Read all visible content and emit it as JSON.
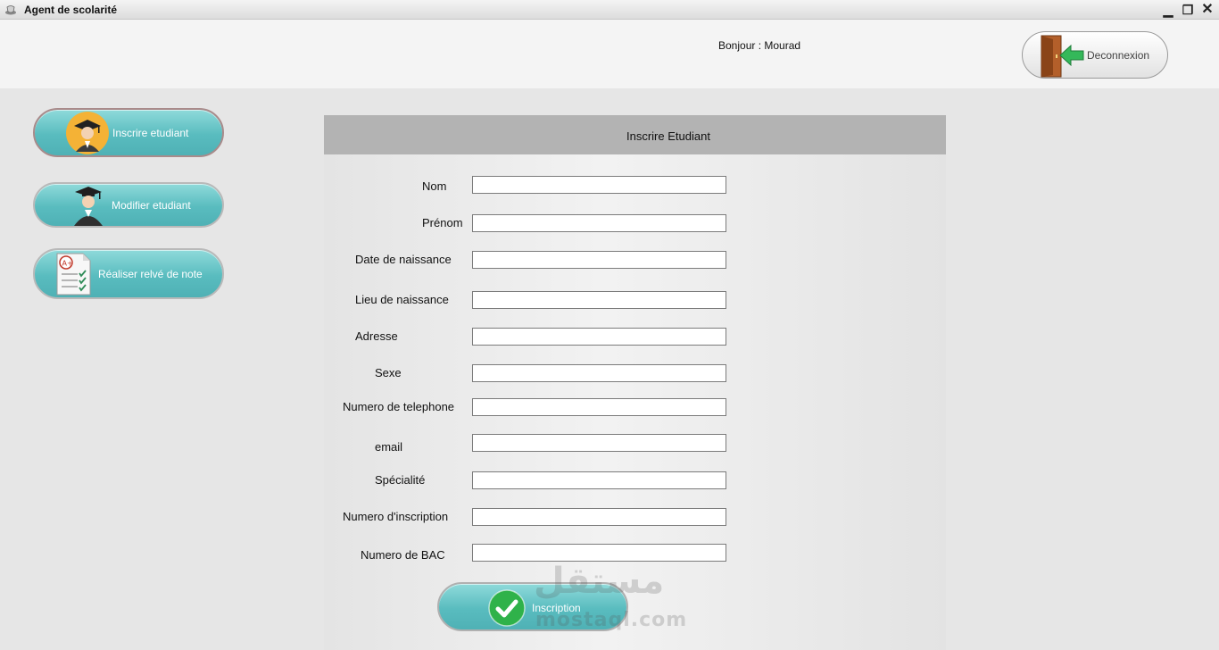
{
  "window": {
    "title": "Agent de scolarité",
    "minimize_glyph": "▁",
    "maximize_glyph": "❐",
    "close_glyph": "✕"
  },
  "header": {
    "greeting": "Bonjour : Mourad",
    "logout_label": "Deconnexion",
    "logout_icon": "door-exit-icon"
  },
  "sidebar": {
    "items": [
      {
        "label": "Inscrire etudiant",
        "icon": "graduate-student-icon"
      },
      {
        "label": "Modifier etudiant",
        "icon": "graduate-icon"
      },
      {
        "label": "Réaliser relvé de note",
        "icon": "grade-report-icon"
      }
    ]
  },
  "form": {
    "title": "Inscrire Etudiant",
    "fields": [
      {
        "label": "Nom",
        "value": ""
      },
      {
        "label": "Prénom",
        "value": ""
      },
      {
        "label": "Date de naissance",
        "value": ""
      },
      {
        "label": "Lieu de naissance",
        "value": ""
      },
      {
        "label": "Adresse",
        "value": ""
      },
      {
        "label": "Sexe",
        "value": ""
      },
      {
        "label": "Numero de telephone",
        "value": ""
      },
      {
        "label": "email",
        "value": ""
      },
      {
        "label": "Spécialité",
        "value": ""
      },
      {
        "label": "Numero d'inscription",
        "value": ""
      },
      {
        "label": "Numero de BAC",
        "value": ""
      }
    ],
    "submit_label": "Inscription",
    "submit_icon": "checkmark-icon"
  },
  "watermark": {
    "arabic": "مستقل",
    "latin": "mostaql.com"
  },
  "colors": {
    "button_teal": "#59bcbf",
    "header_gray": "#b3b3b3",
    "check_green": "#2fb24a"
  }
}
